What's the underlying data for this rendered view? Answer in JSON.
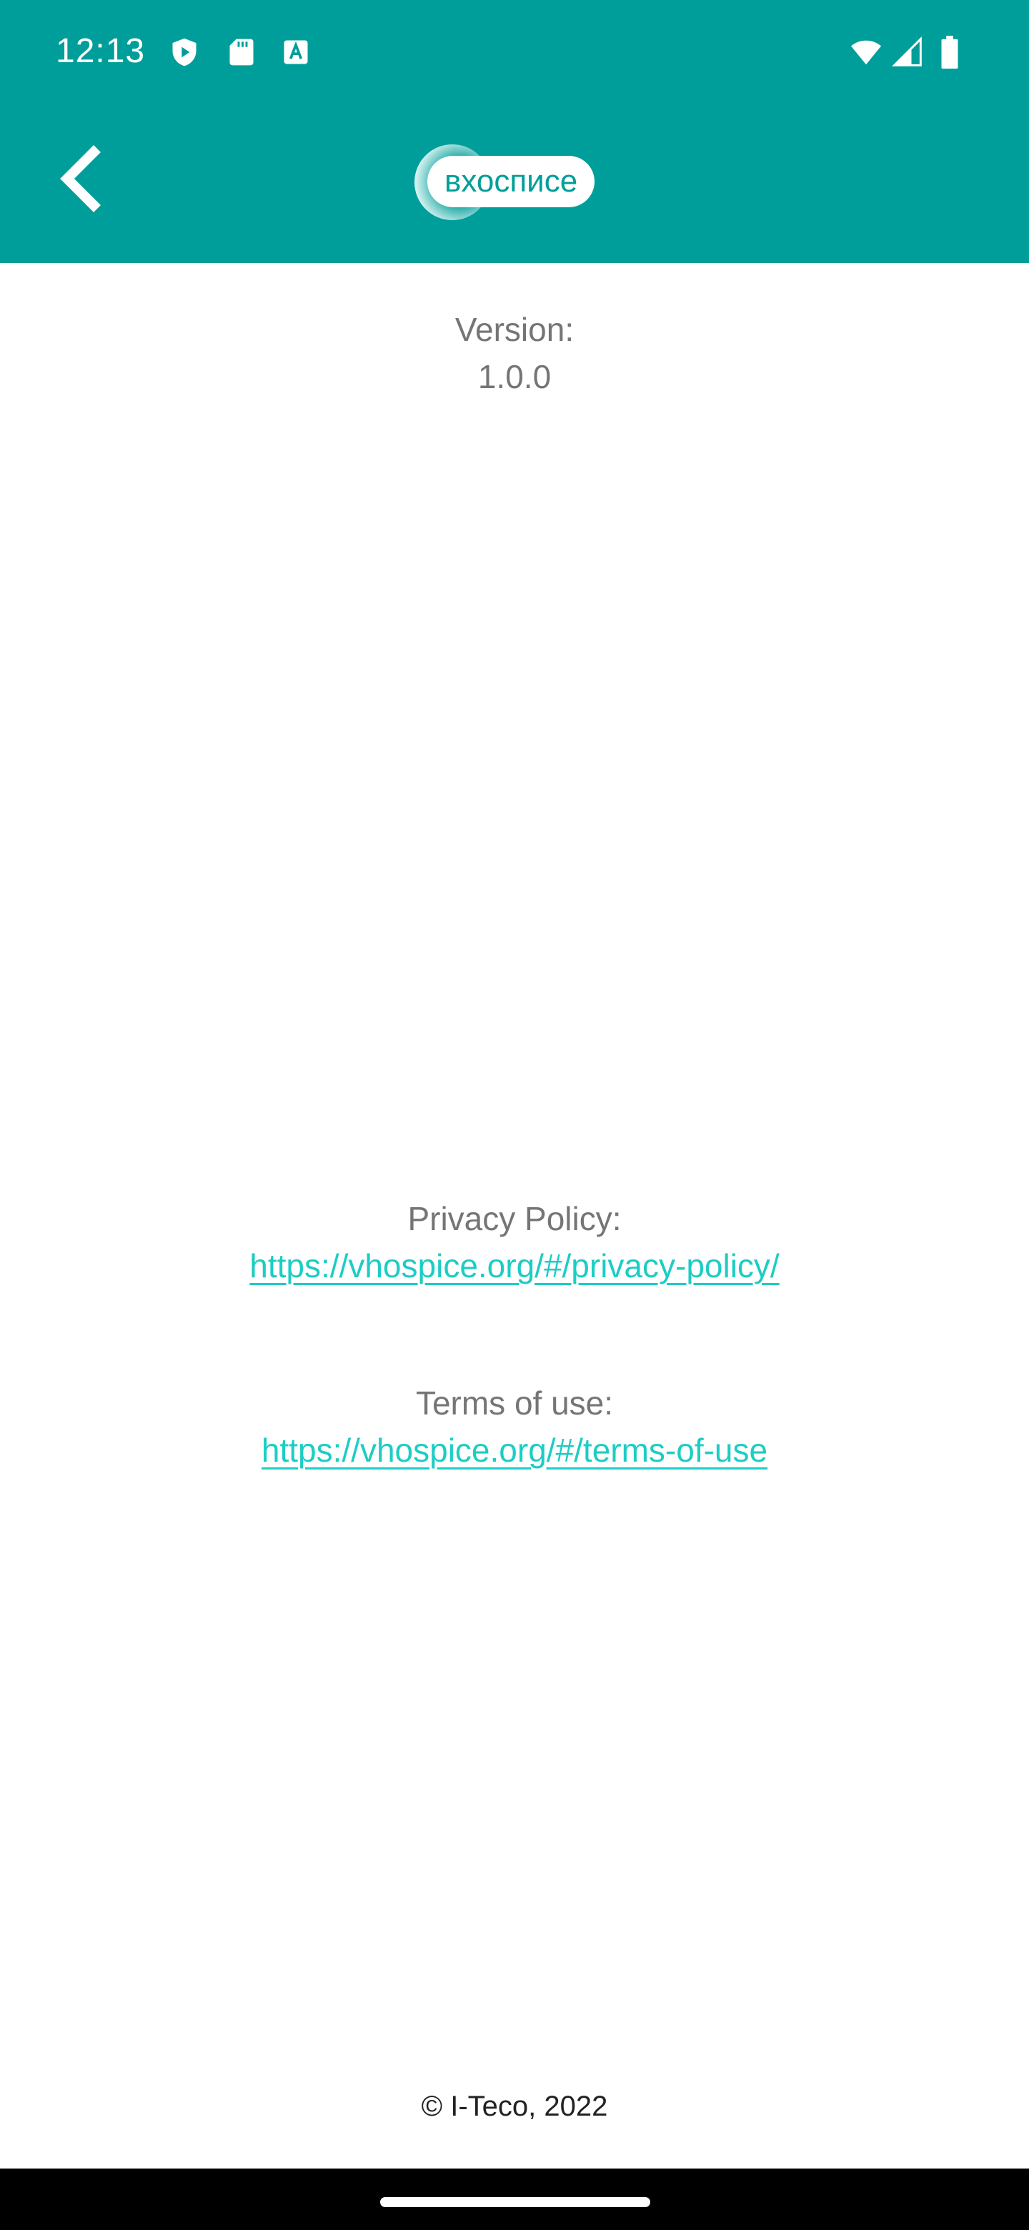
{
  "status_bar": {
    "time": "12:13",
    "left_icons": [
      "play-protect-icon",
      "sd-card-icon",
      "text-a-icon"
    ],
    "right_icons": [
      "wifi-icon",
      "cell-signal-icon",
      "battery-icon"
    ]
  },
  "app_bar": {
    "back_icon": "chevron-left-icon",
    "logo_text": "вхосписе"
  },
  "version": {
    "label": "Version:",
    "value": "1.0.0"
  },
  "privacy": {
    "label": "Privacy Policy:",
    "link": "https://vhospice.org/#/privacy-policy/"
  },
  "terms": {
    "label": "Terms of use:",
    "link": "https://vhospice.org/#/terms-of-use"
  },
  "footer": {
    "copyright": "© I-Teco, 2022"
  },
  "colors": {
    "primary": "#009e9a",
    "link": "#1ccdc4",
    "muted_text": "#757575"
  }
}
